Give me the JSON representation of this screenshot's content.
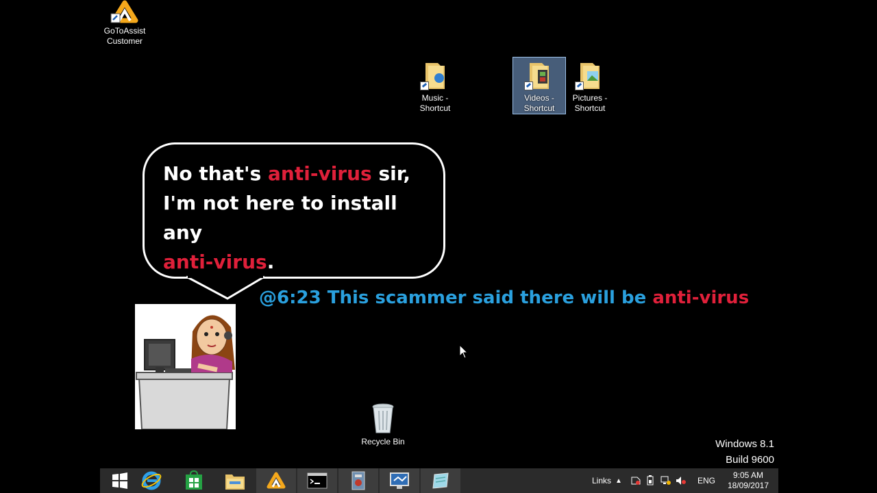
{
  "desktop": {
    "icons": [
      {
        "label_line1": "GoToAssist",
        "label_line2": "Customer",
        "icon": "gotoassist-icon"
      },
      {
        "label_line1": "Music -",
        "label_line2": "Shortcut",
        "icon": "music-folder-icon"
      },
      {
        "label_line1": "Videos -",
        "label_line2": "Shortcut",
        "icon": "videos-folder-icon",
        "selected": true
      },
      {
        "label_line1": "Pictures -",
        "label_line2": "Shortcut",
        "icon": "pictures-folder-icon"
      },
      {
        "label_line1": "Recycle Bin",
        "label_line2": "",
        "icon": "recycle-bin-icon"
      }
    ],
    "watermark": {
      "line1": "Windows 8.1",
      "line2": "Build 9600"
    }
  },
  "overlay": {
    "bubble": {
      "l1_a": "No that's ",
      "l1_b": "anti-virus",
      "l1_c": " sir,",
      "l2": "I'm not here to install any",
      "l3_a": "anti-virus",
      "l3_b": "."
    },
    "caption": {
      "a": "@6:23 This scammer said there will be ",
      "b": "anti-virus"
    }
  },
  "taskbar": {
    "buttons": [
      "start-icon",
      "internet-explorer-icon",
      "store-icon",
      "file-explorer-icon",
      "gotoassist-icon",
      "command-prompt-icon",
      "security-tool-icon",
      "remote-desktop-icon",
      "notepad-icon"
    ],
    "tray": {
      "links": "Links",
      "language": "ENG",
      "time": "9:05 AM",
      "date": "18/09/2017"
    }
  },
  "colors": {
    "highlight": "#e0203a",
    "caption": "#2aa0de",
    "taskbar": "#2b2b2b"
  }
}
